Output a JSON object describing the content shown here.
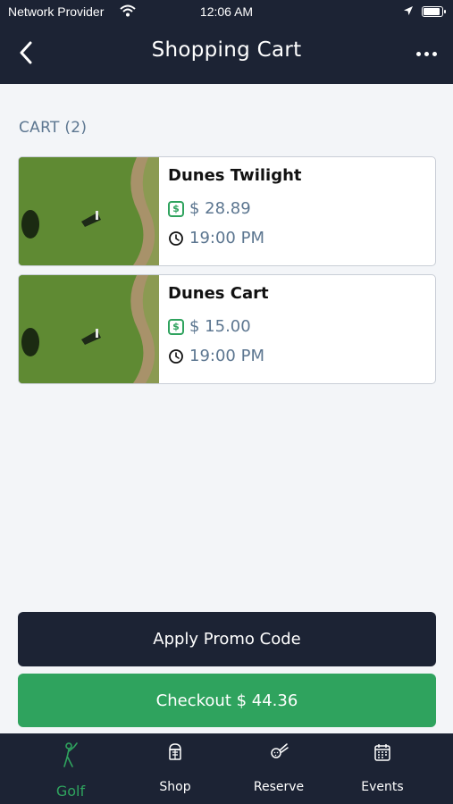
{
  "status_bar": {
    "carrier": "Network Provider",
    "time": "12:06 AM",
    "battery_level": 0.85
  },
  "header": {
    "title": "Shopping Cart"
  },
  "cart": {
    "section_label": "CART (2)",
    "items": [
      {
        "name": "Dunes Twilight",
        "price": "$ 28.89",
        "time": "19:00 PM"
      },
      {
        "name": "Dunes Cart",
        "price": "$ 15.00",
        "time": "19:00 PM"
      }
    ]
  },
  "actions": {
    "promo_label": "Apply Promo Code",
    "checkout_label": "Checkout $ 44.36"
  },
  "tabs": [
    {
      "label": "Golf",
      "icon": "golfer-icon",
      "active": true
    },
    {
      "label": "Shop",
      "icon": "shop-icon",
      "active": false
    },
    {
      "label": "Reserve",
      "icon": "reserve-icon",
      "active": false
    },
    {
      "label": "Events",
      "icon": "calendar-icon",
      "active": false
    }
  ],
  "colors": {
    "header_bg": "#1c2334",
    "accent_green": "#2fa35e",
    "secondary_text": "#5c7690",
    "page_bg": "#f3f5f8"
  }
}
